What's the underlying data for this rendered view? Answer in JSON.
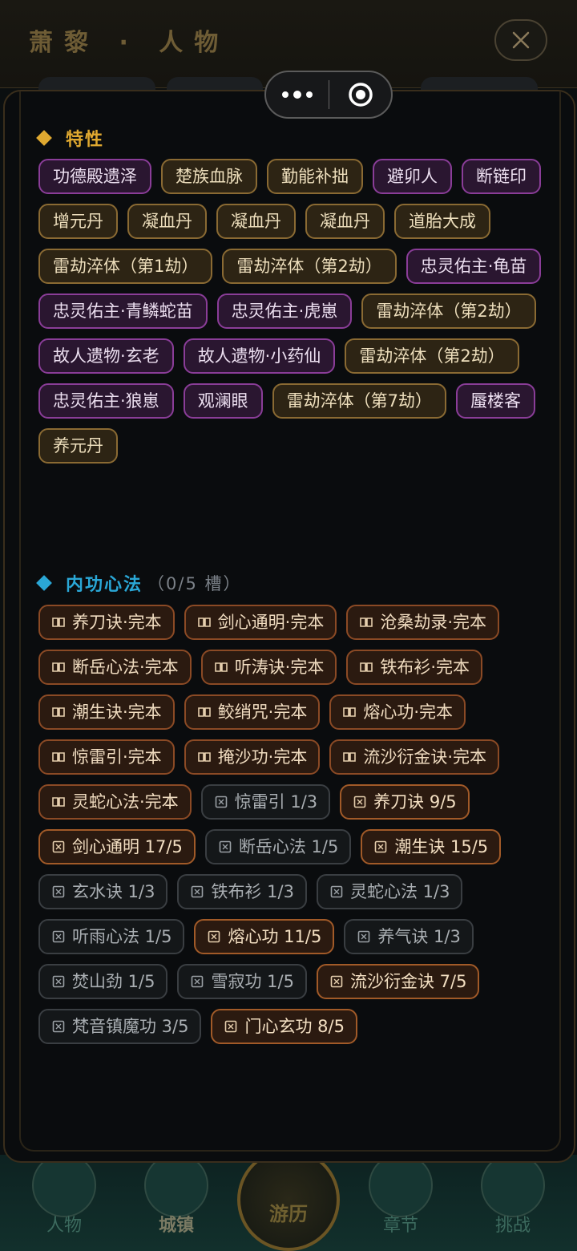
{
  "header": {
    "title": "萧黎 · 人物"
  },
  "capsule": {
    "more_icon": "more-dots-icon",
    "close_icon": "target-icon"
  },
  "traits": {
    "heading": "特性",
    "accent": "#e0a930",
    "items": [
      {
        "label": "功德殿遗泽",
        "style": "purple"
      },
      {
        "label": "楚族血脉",
        "style": "gold"
      },
      {
        "label": "勤能补拙",
        "style": "gold"
      },
      {
        "label": "避卯人",
        "style": "purple"
      },
      {
        "label": "断链印",
        "style": "purple"
      },
      {
        "label": "增元丹",
        "style": "gold"
      },
      {
        "label": "凝血丹",
        "style": "gold"
      },
      {
        "label": "凝血丹",
        "style": "gold"
      },
      {
        "label": "凝血丹",
        "style": "gold"
      },
      {
        "label": "道胎大成",
        "style": "gold"
      },
      {
        "label": "雷劫淬体（第1劫）",
        "style": "gold"
      },
      {
        "label": "雷劫淬体（第2劫）",
        "style": "gold"
      },
      {
        "label": "忠灵佑主·龟苗",
        "style": "purple"
      },
      {
        "label": "忠灵佑主·青鳞蛇苗",
        "style": "purple"
      },
      {
        "label": "忠灵佑主·虎崽",
        "style": "purple"
      },
      {
        "label": "雷劫淬体（第2劫）",
        "style": "gold"
      },
      {
        "label": "故人遗物·玄老",
        "style": "purple"
      },
      {
        "label": "故人遗物·小药仙",
        "style": "purple"
      },
      {
        "label": "雷劫淬体（第2劫）",
        "style": "gold"
      },
      {
        "label": "忠灵佑主·狼崽",
        "style": "purple"
      },
      {
        "label": "观澜眼",
        "style": "purple"
      },
      {
        "label": "雷劫淬体（第7劫）",
        "style": "gold"
      },
      {
        "label": "蜃楼客",
        "style": "purple"
      },
      {
        "label": "养元丹",
        "style": "gold"
      }
    ]
  },
  "neigong": {
    "heading": "内功心法",
    "slots": "（0/5 槽）",
    "accent": "#2aa7d6",
    "items": [
      {
        "label": "养刀诀·完本",
        "kind": "book"
      },
      {
        "label": "剑心通明·完本",
        "kind": "book"
      },
      {
        "label": "沧桑劫录·完本",
        "kind": "book"
      },
      {
        "label": "断岳心法·完本",
        "kind": "book"
      },
      {
        "label": "听涛诀·完本",
        "kind": "book"
      },
      {
        "label": "铁布衫·完本",
        "kind": "book"
      },
      {
        "label": "潮生诀·完本",
        "kind": "book"
      },
      {
        "label": "鲛绡咒·完本",
        "kind": "book"
      },
      {
        "label": "熔心功·完本",
        "kind": "book"
      },
      {
        "label": "惊雷引·完本",
        "kind": "book"
      },
      {
        "label": "掩沙功·完本",
        "kind": "book"
      },
      {
        "label": "流沙衍金诀·完本",
        "kind": "book"
      },
      {
        "label": "灵蛇心法·完本",
        "kind": "book"
      },
      {
        "label": "惊雷引 1/3",
        "kind": "frag-lo"
      },
      {
        "label": "养刀诀 9/5",
        "kind": "frag-hi"
      },
      {
        "label": "剑心通明 17/5",
        "kind": "frag-hi"
      },
      {
        "label": "断岳心法 1/5",
        "kind": "frag-lo"
      },
      {
        "label": "潮生诀 15/5",
        "kind": "frag-hi"
      },
      {
        "label": "玄水诀 1/3",
        "kind": "frag-lo"
      },
      {
        "label": "铁布衫 1/3",
        "kind": "frag-lo"
      },
      {
        "label": "灵蛇心法 1/3",
        "kind": "frag-lo"
      },
      {
        "label": "听雨心法 1/5",
        "kind": "frag-lo"
      },
      {
        "label": "熔心功 11/5",
        "kind": "frag-hi"
      },
      {
        "label": "养气诀 1/3",
        "kind": "frag-lo"
      },
      {
        "label": "焚山劲 1/5",
        "kind": "frag-lo"
      },
      {
        "label": "雪寂功 1/5",
        "kind": "frag-lo"
      },
      {
        "label": "流沙衍金诀 7/5",
        "kind": "frag-hi"
      },
      {
        "label": "梵音镇魔功 3/5",
        "kind": "frag-lo"
      },
      {
        "label": "门心玄功 8/5",
        "kind": "frag-hi"
      }
    ]
  },
  "bottom_nav": {
    "items": [
      {
        "label": "人物"
      },
      {
        "label": "城镇"
      },
      {
        "label": "游历"
      },
      {
        "label": "章节"
      },
      {
        "label": "挑战"
      }
    ]
  }
}
